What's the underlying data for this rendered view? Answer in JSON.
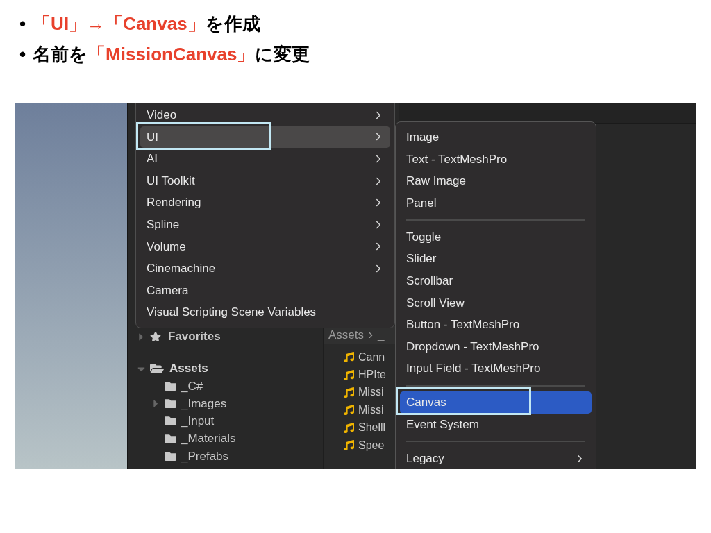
{
  "bullets": [
    {
      "marker": "•",
      "parts": [
        {
          "text": "「UI」→「Canvas」",
          "emphasis": true
        },
        {
          "text": "を作成",
          "emphasis": false
        }
      ]
    },
    {
      "marker": "•",
      "parts": [
        {
          "text": "名前を",
          "emphasis": false
        },
        {
          "text": "「MissionCanvas」",
          "emphasis": true
        },
        {
          "text": "に変更",
          "emphasis": false
        }
      ]
    }
  ],
  "screenshot": {
    "project": {
      "favorites": {
        "label": "Favorites",
        "expanded": false
      },
      "assets": {
        "label": "Assets",
        "expanded": true,
        "children": [
          {
            "label": "_C#",
            "collapsed": false
          },
          {
            "label": "_Images",
            "collapsed": true
          },
          {
            "label": "_Input",
            "collapsed": false
          },
          {
            "label": "_Materials",
            "collapsed": false
          },
          {
            "label": "_Prefabs",
            "collapsed": false
          }
        ]
      },
      "breadcrumb": [
        "Assets",
        "_"
      ],
      "files": [
        "Cann",
        "HPIte",
        "Missi",
        "Missi",
        "Shelll",
        "Spee"
      ]
    },
    "menu": [
      {
        "label": "Video",
        "submenu": true,
        "selected": false,
        "annotated": false
      },
      {
        "label": "UI",
        "submenu": true,
        "selected": true,
        "annotated": true
      },
      {
        "label": "AI",
        "submenu": true,
        "selected": false,
        "annotated": false
      },
      {
        "label": "UI Toolkit",
        "submenu": true,
        "selected": false,
        "annotated": false
      },
      {
        "label": "Rendering",
        "submenu": true,
        "selected": false,
        "annotated": false
      },
      {
        "label": "Spline",
        "submenu": true,
        "selected": false,
        "annotated": false
      },
      {
        "label": "Volume",
        "submenu": true,
        "selected": false,
        "annotated": false
      },
      {
        "label": "Cinemachine",
        "submenu": true,
        "selected": false,
        "annotated": false
      },
      {
        "label": "Camera",
        "submenu": false,
        "selected": false,
        "annotated": false
      },
      {
        "label": "Visual Scripting Scene Variables",
        "submenu": false,
        "selected": false,
        "annotated": false
      }
    ],
    "submenu": [
      {
        "kind": "item",
        "label": "Image",
        "submenu": false,
        "selected": false,
        "annotated": false
      },
      {
        "kind": "item",
        "label": "Text - TextMeshPro",
        "submenu": false,
        "selected": false,
        "annotated": false
      },
      {
        "kind": "item",
        "label": "Raw Image",
        "submenu": false,
        "selected": false,
        "annotated": false
      },
      {
        "kind": "item",
        "label": "Panel",
        "submenu": false,
        "selected": false,
        "annotated": false
      },
      {
        "kind": "separator"
      },
      {
        "kind": "item",
        "label": "Toggle",
        "submenu": false,
        "selected": false,
        "annotated": false
      },
      {
        "kind": "item",
        "label": "Slider",
        "submenu": false,
        "selected": false,
        "annotated": false
      },
      {
        "kind": "item",
        "label": "Scrollbar",
        "submenu": false,
        "selected": false,
        "annotated": false
      },
      {
        "kind": "item",
        "label": "Scroll View",
        "submenu": false,
        "selected": false,
        "annotated": false
      },
      {
        "kind": "item",
        "label": "Button - TextMeshPro",
        "submenu": false,
        "selected": false,
        "annotated": false
      },
      {
        "kind": "item",
        "label": "Dropdown - TextMeshPro",
        "submenu": false,
        "selected": false,
        "annotated": false
      },
      {
        "kind": "item",
        "label": "Input Field - TextMeshPro",
        "submenu": false,
        "selected": false,
        "annotated": false
      },
      {
        "kind": "separator"
      },
      {
        "kind": "item",
        "label": "Canvas",
        "submenu": false,
        "selected": true,
        "annotated": true
      },
      {
        "kind": "item",
        "label": "Event System",
        "submenu": false,
        "selected": false,
        "annotated": false
      },
      {
        "kind": "separator"
      },
      {
        "kind": "item",
        "label": "Legacy",
        "submenu": true,
        "selected": false,
        "annotated": false
      }
    ]
  }
}
